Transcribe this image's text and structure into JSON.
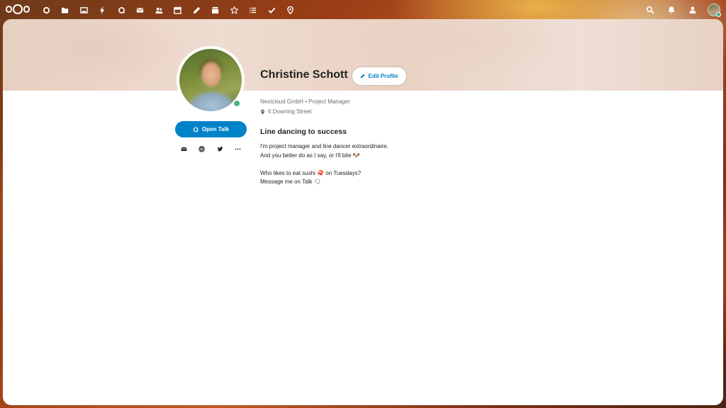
{
  "topbar": {
    "apps": [
      {
        "name": "dashboard-icon",
        "glyph": "○"
      },
      {
        "name": "files-icon",
        "glyph": "folder"
      },
      {
        "name": "photos-icon",
        "glyph": "image"
      },
      {
        "name": "activity-icon",
        "glyph": "bolt"
      },
      {
        "name": "talk-icon",
        "glyph": "talk"
      },
      {
        "name": "mail-icon",
        "glyph": "mail"
      },
      {
        "name": "contacts-icon",
        "glyph": "contacts"
      },
      {
        "name": "calendar-icon",
        "glyph": "calendar"
      },
      {
        "name": "notes-icon",
        "glyph": "pencil"
      },
      {
        "name": "deck-icon",
        "glyph": "deck"
      },
      {
        "name": "social-icon",
        "glyph": "star"
      },
      {
        "name": "tasks-icon",
        "glyph": "list"
      },
      {
        "name": "checks-icon",
        "glyph": "check"
      },
      {
        "name": "maps-icon",
        "glyph": "pin"
      }
    ]
  },
  "profile": {
    "name": "Christine Schott",
    "edit_label": "Edit Profile",
    "organisation": "Nextcloud GmbH",
    "role": "Project Manager",
    "org_line": "Nextcloud GmbH • Project Manager",
    "address": "6 Downing Street",
    "headline": "Line dancing to success",
    "bio": [
      "I'm project manager and line dancer extraordinaire.",
      "And you better do as I say, or I'll bite 🐶",
      "",
      "Who likes to eat sushi 🍣  on Tuesdays?",
      "Message me on Talk 🗨"
    ],
    "open_talk_label": "Open Talk"
  },
  "colors": {
    "primary": "#0082c9",
    "status_online": "#49b382"
  }
}
